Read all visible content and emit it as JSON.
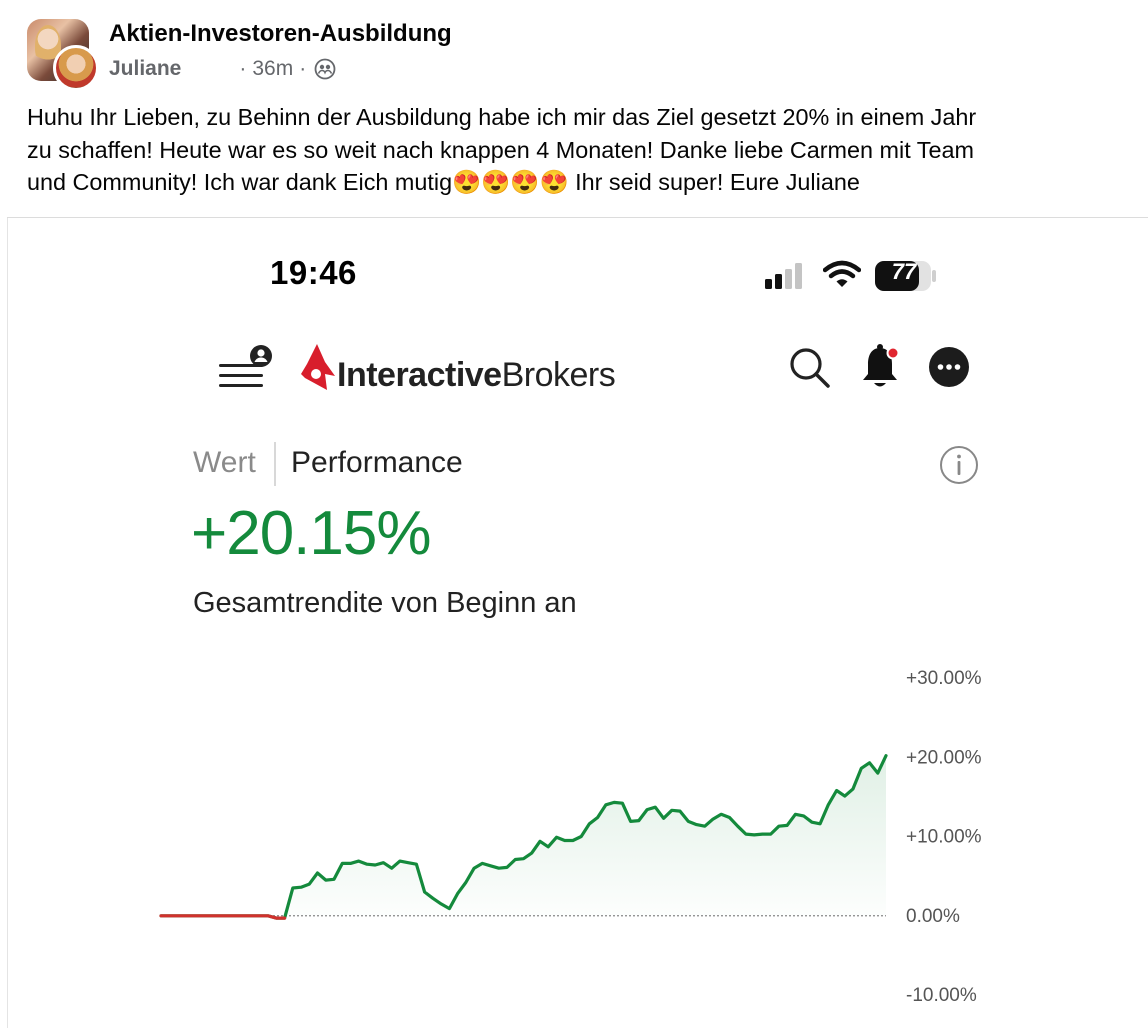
{
  "post": {
    "group_name": "Aktien-Investoren-Ausbildung",
    "author": "Juliane",
    "separator": "·",
    "timestamp": "36m",
    "separator2": "·",
    "audience_icon": "group-members-icon",
    "text": "Huhu Ihr Lieben, zu Behinn der Ausbildung habe ich mir das Ziel gesetzt 20% in einem Jahr\nzu schaffen! Heute war es so weit nach knappen 4 Monaten! Danke liebe Carmen mit Team\nund Community! Ich war dank Eich mutig😍😍😍😍 Ihr seid super! Eure Juliane"
  },
  "phone": {
    "status_time": "19:46",
    "battery": "77",
    "icons": [
      "signal-icon",
      "wifi-icon",
      "battery-icon"
    ]
  },
  "app": {
    "logo_bold": "Interactive",
    "logo_regular": "Brokers",
    "icons": [
      "menu-icon",
      "search-icon",
      "bell-icon",
      "more-icon",
      "info-icon"
    ],
    "brand_color": "#d81e2c",
    "tab_wert": "Wert",
    "tab_performance": "Performance",
    "performance_value": "+20.15%",
    "performance_caption": "Gesamtrendite von Beginn an",
    "positive_color": "#148a3c",
    "negative_color": "#d0312d"
  },
  "chart_data": {
    "type": "line",
    "y_ticks": [
      "+30.00%",
      "+20.00%",
      "+10.00%",
      "0.00%",
      "-10.00%"
    ],
    "ylim": [
      -10,
      30
    ],
    "series": [
      {
        "values": [
          0,
          0,
          0,
          0,
          0,
          0,
          0,
          0,
          0,
          0,
          0,
          0,
          0,
          0,
          -0.3,
          -0.3,
          3.5,
          3.6,
          4.0,
          5.4,
          4.5,
          4.6,
          6.6,
          6.6,
          6.9,
          6.5,
          6.4,
          6.7,
          6.0,
          6.9,
          6.7,
          6.5,
          3.0,
          2.2,
          1.5,
          0.9,
          2.8,
          4.2,
          6.0,
          6.6,
          6.3,
          6.0,
          6.1,
          7.1,
          7.2,
          7.9,
          9.4,
          8.7,
          9.9,
          9.5,
          9.5,
          10.0,
          11.6,
          12.4,
          14.0,
          14.3,
          14.2,
          11.9,
          12.0,
          13.4,
          13.7,
          12.3,
          13.3,
          13.2,
          11.9,
          11.5,
          11.3,
          12.2,
          12.8,
          12.4,
          11.3,
          10.3,
          10.2,
          10.3,
          10.3,
          11.3,
          11.4,
          12.8,
          12.6,
          11.8,
          11.6,
          14.0,
          15.8,
          15.1,
          16.0,
          18.6,
          19.3,
          18.0,
          20.2
        ]
      }
    ]
  }
}
